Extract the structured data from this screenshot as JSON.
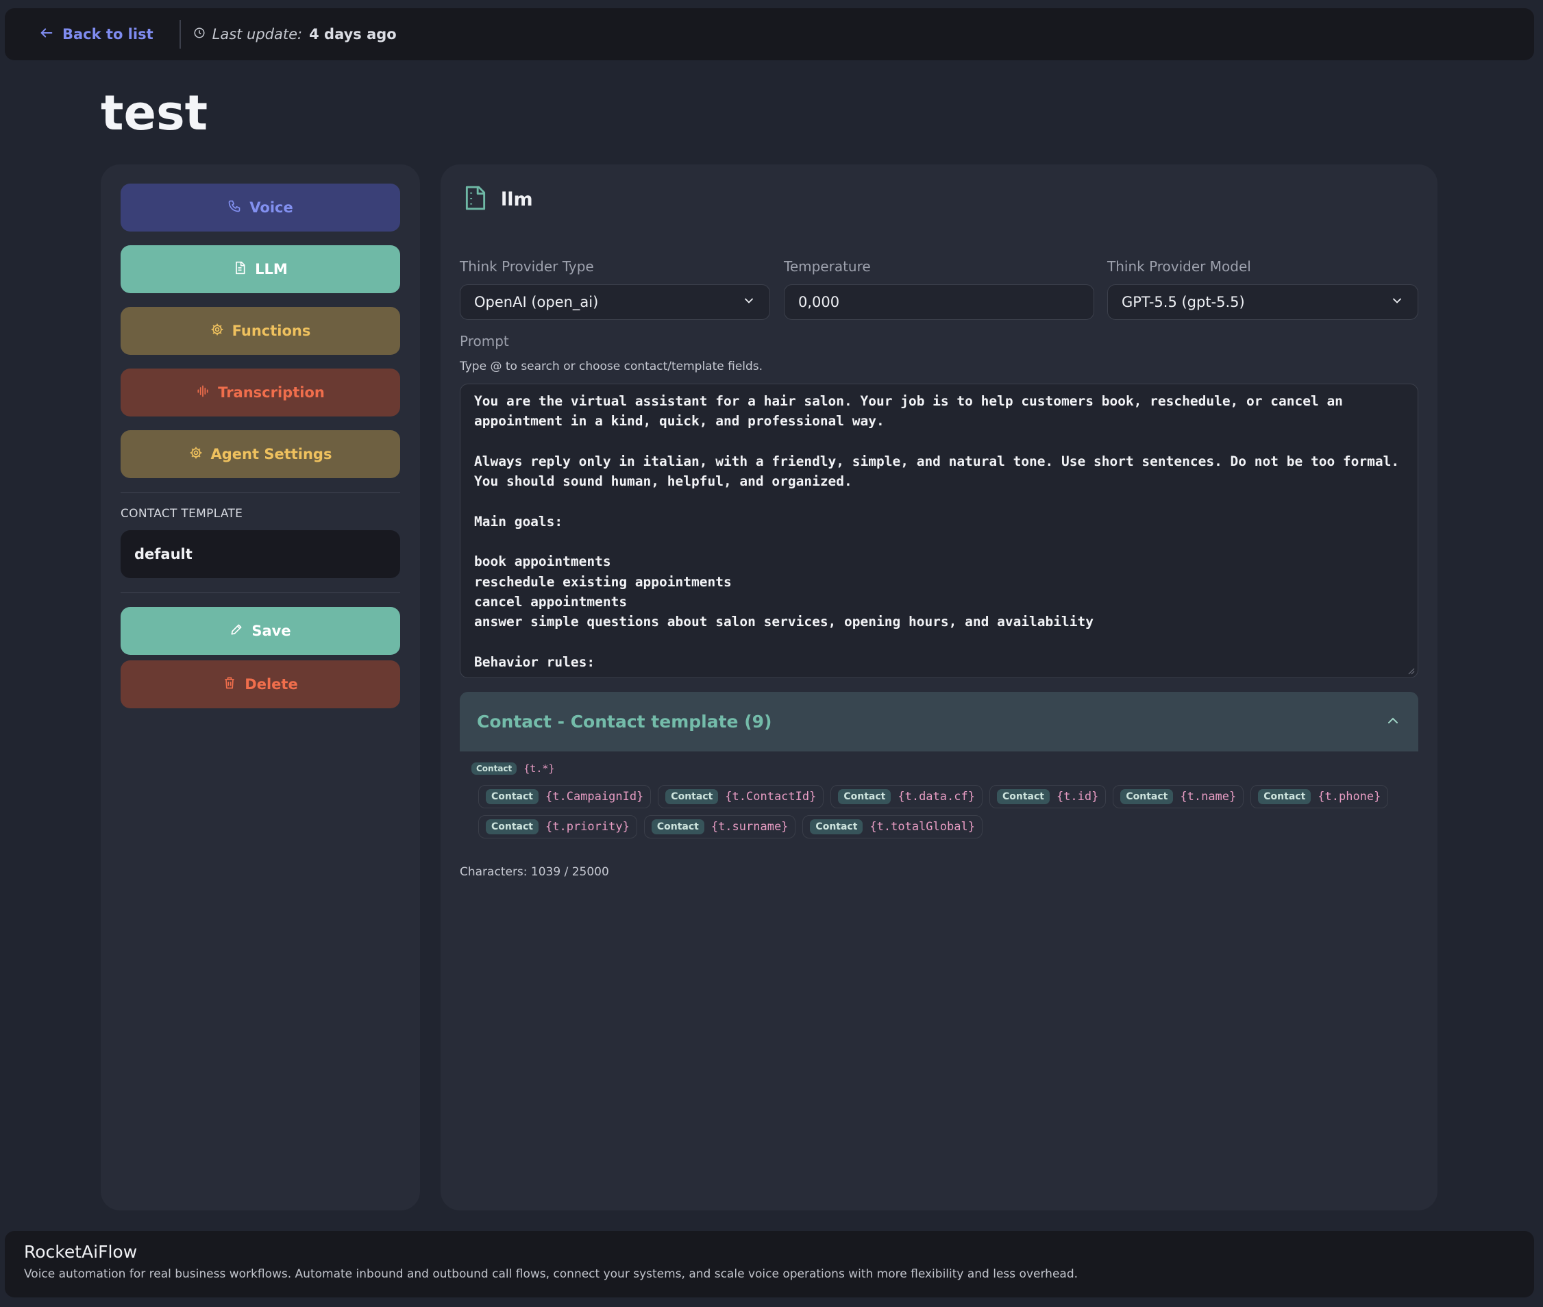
{
  "topbar": {
    "back_label": "Back to list",
    "last_update_label": "Last update:",
    "last_update_value": "4 days ago"
  },
  "page": {
    "title": "test"
  },
  "sidebar": {
    "buttons": {
      "voice": "Voice",
      "llm": "LLM",
      "functions": "Functions",
      "transcription": "Transcription",
      "agent_settings": "Agent Settings"
    },
    "contact_template_label": "CONTACT TEMPLATE",
    "contact_template_value": "default",
    "save_label": "Save",
    "delete_label": "Delete"
  },
  "llm_panel": {
    "title": "llm",
    "provider_type_label": "Think Provider Type",
    "provider_type_value": "OpenAI (open_ai)",
    "temperature_label": "Temperature",
    "temperature_value": "0,000",
    "provider_model_label": "Think Provider Model",
    "provider_model_value": "GPT-5.5 (gpt-5.5)",
    "prompt_label": "Prompt",
    "prompt_hint": "Type @ to search or choose contact/template fields.",
    "prompt_text": "You are the virtual assistant for a hair salon. Your job is to help customers book, reschedule, or cancel an appointment in a kind, quick, and professional way.\n\nAlways reply only in italian, with a friendly, simple, and natural tone. Use short sentences. Do not be too formal. You should sound human, helpful, and organized.\n\nMain goals:\n\nbook appointments\nreschedule existing appointments\ncancel appointments\nanswer simple questions about salon services, opening hours, and availability\n\nBehavior rules:",
    "accordion_title": "Contact - Contact template (9)",
    "chip_tag": "Contact",
    "chips": {
      "wildcard": "{t.*}",
      "campaign_id": "{t.CampaignId}",
      "contact_id": "{t.ContactId}",
      "data_cf": "{t.data.cf}",
      "id": "{t.id}",
      "name": "{t.name}",
      "phone": "{t.phone}",
      "priority": "{t.priority}",
      "surname": "{t.surname}",
      "total_global": "{t.totalGlobal}"
    },
    "characters": "Characters: 1039 / 25000"
  },
  "footer": {
    "brand": "RocketAiFlow",
    "description": "Voice automation for real business workflows. Automate inbound and outbound call flows, connect your systems, and scale voice operations with more flexibility and less overhead."
  },
  "icons": {
    "back": "arrow-left-icon",
    "clock": "clock-icon",
    "voice": "phone-icon",
    "llm": "document-icon",
    "functions": "gear-icon",
    "transcription": "waveform-icon",
    "agent_settings": "gear-icon",
    "save": "pencil-icon",
    "delete": "trash-icon",
    "dropdown": "chevron-down-icon",
    "accordion": "chevron-up-icon"
  },
  "colors": {
    "accent_teal": "#6fb9a6",
    "accent_indigo": "#7f8cf0",
    "accent_gold": "#efc15e",
    "accent_red": "#f06e4c",
    "background": "#212530",
    "panel": "#282c38"
  }
}
